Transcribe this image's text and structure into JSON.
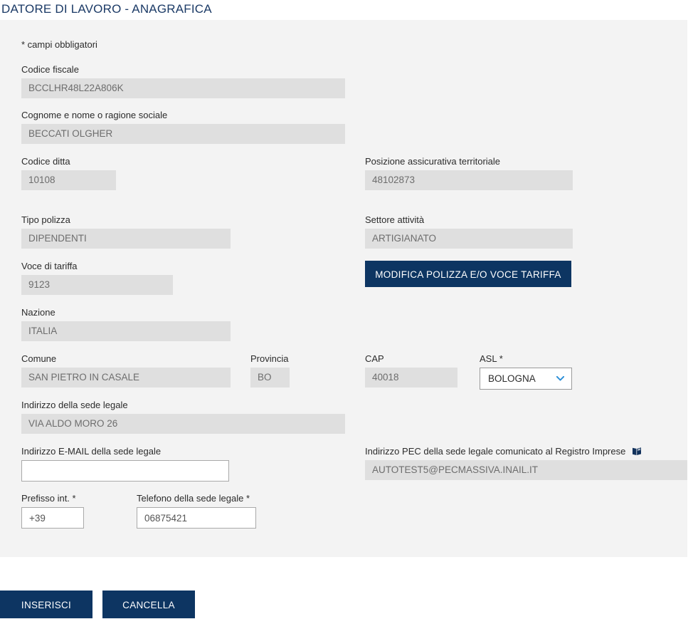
{
  "page": {
    "title": "DATORE DI LAVORO - ANAGRAFICA",
    "required_note": "*  campi obbligatori"
  },
  "form": {
    "codice_fiscale": {
      "label": "Codice fiscale",
      "value": "BCCLHR48L22A806K"
    },
    "cognome_nome": {
      "label": "Cognome e nome o ragione sociale",
      "value": "BECCATI OLGHER"
    },
    "codice_ditta": {
      "label": "Codice ditta",
      "value": "10108"
    },
    "posizione_assicurativa": {
      "label": "Posizione assicurativa territoriale",
      "value": "48102873"
    },
    "tipo_polizza": {
      "label": "Tipo polizza",
      "value": "DIPENDENTI"
    },
    "settore_attivita": {
      "label": "Settore attività",
      "value": "ARTIGIANATO"
    },
    "voce_tariffa": {
      "label": "Voce di tariffa",
      "value": "9123"
    },
    "nazione": {
      "label": "Nazione",
      "value": "ITALIA"
    },
    "comune": {
      "label": "Comune",
      "value": "SAN PIETRO IN CASALE"
    },
    "provincia": {
      "label": "Provincia",
      "value": "BO"
    },
    "cap": {
      "label": "CAP",
      "value": "40018"
    },
    "asl": {
      "label": "ASL *",
      "selected": "BOLOGNA",
      "options": [
        "BOLOGNA"
      ]
    },
    "indirizzo_sede": {
      "label": "Indirizzo della sede legale",
      "value": "VIA ALDO MORO 26"
    },
    "email_sede": {
      "label": "Indirizzo E-MAIL della sede legale",
      "value": "",
      "placeholder": ""
    },
    "pec_sede": {
      "label": "Indirizzo PEC della sede legale comunicato al Registro Imprese",
      "icon": "book-icon",
      "value": "AUTOTEST5@PECMASSIVA.INAIL.IT"
    },
    "prefisso": {
      "label": "Prefisso int. *",
      "value": "+39"
    },
    "telefono": {
      "label": "Telefono della sede legale *",
      "value": "06875421"
    }
  },
  "buttons": {
    "modifica_polizza": "MODIFICA POLIZZA E/O VOCE TARIFFA",
    "inserisci": "INSERISCI",
    "cancella": "CANCELLA"
  },
  "colors": {
    "title_blue": "#1b3a66",
    "button_blue": "#0d3562",
    "panel_bg": "#f3f3f3",
    "readonly_bg": "#dfdfdf",
    "chevron_blue": "#2b8fd8"
  }
}
